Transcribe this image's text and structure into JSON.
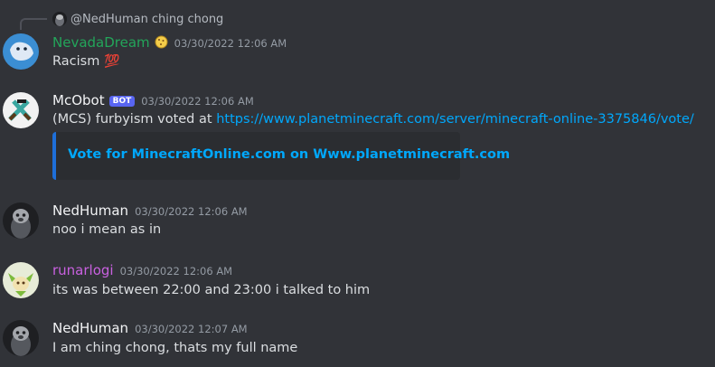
{
  "reply": {
    "author": "@NedHuman",
    "text": "ching chong"
  },
  "messages": [
    {
      "author": "NevadaDream",
      "author_color": "#23a55a",
      "timestamp": "03/30/2022 12:06 AM",
      "content": "Racism",
      "content_emoji": "💯"
    },
    {
      "author": "McObot",
      "author_color": "#f2f3f5",
      "badge": "BOT",
      "timestamp": "03/30/2022 12:06 AM",
      "content_prefix": "(MCS) furbyism voted at ",
      "content_link": "https://www.planetminecraft.com/server/minecraft-online-3375846/vote/",
      "embed_title": "Vote for MinecraftOnline.com on Www.planetminecraft.com"
    },
    {
      "author": "NedHuman",
      "author_color": "#f2f3f5",
      "timestamp": "03/30/2022 12:06 AM",
      "content": "noo i mean as in"
    },
    {
      "author": "runarlogi",
      "author_color": "#c961e0",
      "timestamp": "03/30/2022 12:06 AM",
      "content": "its was between 22:00 and 23:00 i talked to him"
    },
    {
      "author": "NedHuman",
      "author_color": "#f2f3f5",
      "timestamp": "03/30/2022 12:07 AM",
      "content": "I am ching chong, thats my full name"
    }
  ],
  "colors": {
    "background": "#313338",
    "link": "#00a8fc",
    "bot_badge": "#5865f2",
    "timestamp": "#949ba4"
  }
}
